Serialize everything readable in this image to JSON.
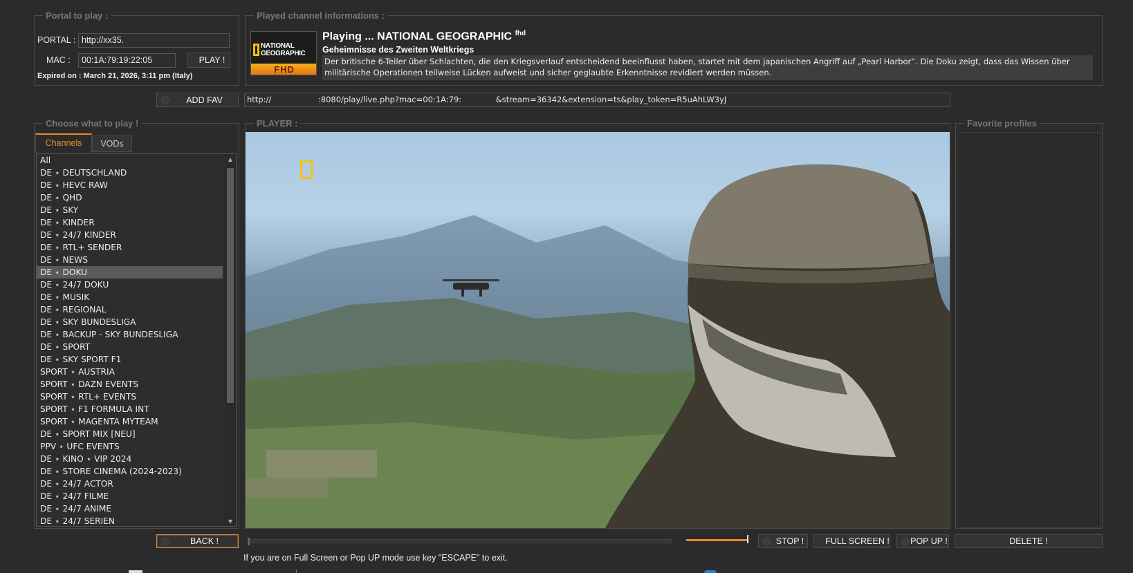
{
  "portal": {
    "legend": "Portal to play :",
    "portal_label": "PORTAL :",
    "portal_value": "http://xx35.",
    "mac_label": "MAC :",
    "mac_value": "00:1A:79:19:22:05",
    "play_button": "PLAY !",
    "expired": "Expired on : March 21, 2026, 3:11 pm (Italy)"
  },
  "channel_info": {
    "legend": "Played channel informations :",
    "logo_line1": "NATIONAL",
    "logo_line2": "GEOGRAPHIC",
    "logo_badge": "FHD",
    "playing_title": "Playing ... NATIONAL GEOGRAPHIC",
    "playing_sup": "fhd",
    "program_title": "Geheimnisse des Zweiten Weltkriegs",
    "description": "Der britische 6-Teiler über Schlachten, die den Kriegsverlauf entscheidend beeinflusst haben, startet mit dem japanischen Angriff auf „Pearl Harbor“. Die Doku zeigt, dass das Wissen über militärische Operationen teilweise Lücken aufweist und sicher geglaubte Erkenntnisse revidiert werden müssen."
  },
  "add_fav_button": "ADD FAV",
  "stream_url": {
    "part1": "http://",
    "part2": ":8080/play/live.php?mac=00:1A:79:",
    "part3": "&stream=36342&extension=ts&play_token=R5uAhLW3yJ"
  },
  "choose": {
    "legend": "Choose what to play !",
    "tabs": [
      "Channels",
      "VODs"
    ],
    "items": [
      "All",
      "DE ⋆ DEUTSCHLAND",
      "DE ⋆ HEVC RAW",
      "DE ⋆ QHD",
      "DE ⋆ SKY",
      "DE ⋆ KINDER",
      "DE ⋆ 24/7 KINDER",
      "DE ⋆ RTL+ SENDER",
      "DE ⋆ NEWS",
      "DE ⋆ DOKU",
      "DE ⋆ 24/7 DOKU",
      "DE ⋆ MUSIK",
      "DE ⋆ REGIONAL",
      "DE ⋆ SKY BUNDESLIGA",
      "DE ⋆ BACKUP - SKY BUNDESLIGA",
      "DE ⋆ SPORT",
      "DE ⋆ SKY SPORT F1",
      "SPORT ⋆ AUSTRIA",
      "SPORT ⋆ DAZN EVENTS",
      "SPORT ⋆ RTL+ EVENTS",
      "SPORT ⋆ F1 FORMULA INT",
      "SPORT ⋆ MAGENTA MYTEAM",
      "DE ⋆ SPORT MIX [NEU]",
      "PPV ⋆ UFC EVENTS",
      "DE  ⋆ KINO ⋆ VIP 2024",
      "DE ⋆ STORE CINEMA (2024-2023)",
      "DE ⋆ 24/7 ACTOR",
      "DE ⋆ 24/7 FILME",
      "DE ⋆ 24/7 ANIME",
      "DE ⋆ 24/7 SERIEN"
    ],
    "selected_index": 9
  },
  "player": {
    "legend": "PLAYER :",
    "volume_percent": 100
  },
  "favorites": {
    "legend": "Favorite profiles"
  },
  "buttons": {
    "back": "BACK !",
    "stop": "STOP !",
    "fullscreen": "FULL SCREEN !",
    "popup": "POP UP !",
    "delete": "DELETE !"
  },
  "hint": "If you are on Full Screen or Pop UP mode use key \"ESCAPE\" to exit.",
  "colors": {
    "accent": "#e8892a",
    "background": "#2b2b2b",
    "natgeo_yellow": "#f5c400"
  }
}
